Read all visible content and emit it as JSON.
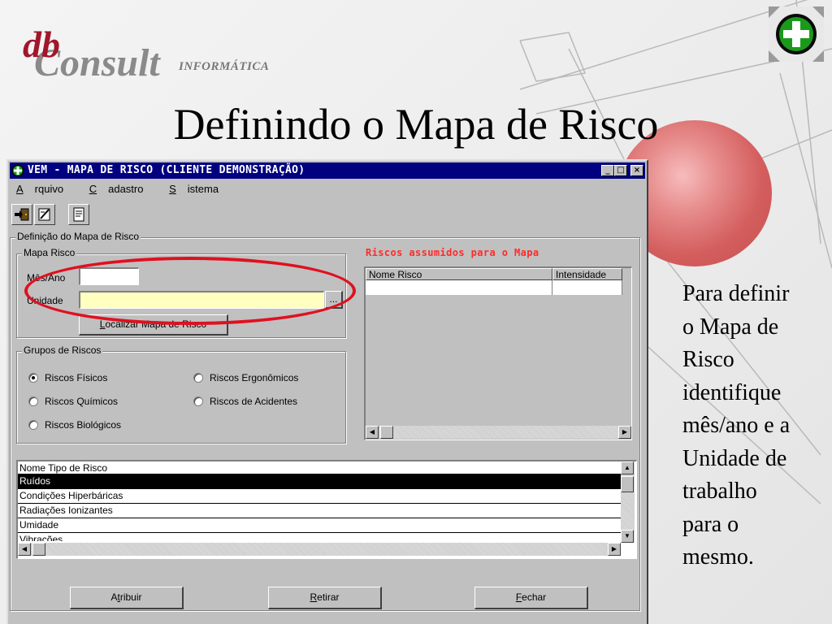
{
  "slide": {
    "logo": {
      "db": "db",
      "consult": "Consult",
      "tag": "INFORMÁTICA"
    },
    "title": "Definindo o Mapa de Risco",
    "side_text_lines": [
      "Para definir",
      "o Mapa de",
      "Risco",
      "identifique",
      "mês/ano e a",
      "Unidade de",
      "trabalho",
      "para o",
      "mesmo."
    ],
    "badge_icon": "green-plus-icon",
    "accent_color": "#e01020"
  },
  "window": {
    "title": "VEM - MAPA DE RISCO (CLIENTE DEMONSTRAÇÃO)",
    "controls": {
      "minimize": "_",
      "maximize": "□",
      "close": "×"
    },
    "menu": [
      {
        "first": "A",
        "rest": "rquivo"
      },
      {
        "first": "C",
        "rest": "adastro"
      },
      {
        "first": "S",
        "rest": "istema"
      }
    ],
    "toolbar_icons": [
      "exit-door-icon",
      "edit-note-icon",
      "report-icon"
    ]
  },
  "definition": {
    "group_label": "Definição do Mapa de Risco",
    "mapa_group_label": "Mapa Risco",
    "mes_ano_label": "Mês/Ano",
    "mes_ano_value": "",
    "unidade_label": "Unidade",
    "unidade_value": "",
    "browse_label": "...",
    "locate_button": {
      "first": "L",
      "rest": "ocalizar Mapa de Risco"
    }
  },
  "grupos": {
    "label": "Grupos de Riscos",
    "options": [
      {
        "label": "Riscos Físicos",
        "selected": true
      },
      {
        "label": "Riscos Químicos",
        "selected": false
      },
      {
        "label": "Riscos Biológicos",
        "selected": false
      },
      {
        "label": "Riscos Ergonômicos",
        "selected": false
      },
      {
        "label": "Riscos de Acidentes",
        "selected": false
      }
    ]
  },
  "riscos_assumidos": {
    "title": "Riscos assumidos para o Mapa",
    "columns": [
      "Nome Risco",
      "Intensidade"
    ]
  },
  "tipo_list": {
    "header": "Nome Tipo de Risco",
    "rows": [
      "Ruídos",
      "Condições Hiperbáricas",
      "Radiações Ionizantes",
      "Umidade",
      "Vibrações"
    ],
    "selected_index": 0
  },
  "buttons": {
    "atribuir": {
      "first": "A",
      "u": "t",
      "rest": "ribuir"
    },
    "retirar": {
      "first": "",
      "u": "R",
      "rest": "etirar"
    },
    "fechar": {
      "first": "",
      "u": "F",
      "rest": "echar"
    }
  }
}
